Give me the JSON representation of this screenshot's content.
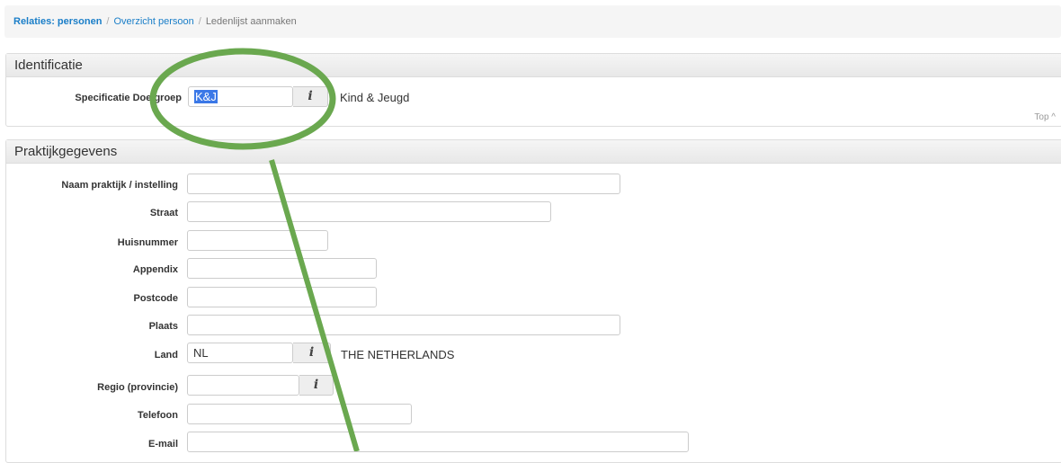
{
  "breadcrumb": {
    "items": [
      "Relaties: personen",
      "Overzicht persoon",
      "Ledenlijst aanmaken"
    ],
    "separator": "/"
  },
  "identificatie": {
    "title": "Identificatie",
    "field_label": "Specificatie Doelgroep",
    "value": "K&J",
    "description": "Kind & Jeugd",
    "top_link": "Top ^",
    "info_icon": "info-icon"
  },
  "praktijk": {
    "title": "Praktijkgegevens",
    "fields": {
      "naam": {
        "label": "Naam praktijk / instelling",
        "value": ""
      },
      "straat": {
        "label": "Straat",
        "value": ""
      },
      "huisnummer": {
        "label": "Huisnummer",
        "value": ""
      },
      "appendix": {
        "label": "Appendix",
        "value": ""
      },
      "postcode": {
        "label": "Postcode",
        "value": ""
      },
      "plaats": {
        "label": "Plaats",
        "value": ""
      },
      "land": {
        "label": "Land",
        "value": "NL",
        "description": "THE NETHERLANDS"
      },
      "regio": {
        "label": "Regio (provincie)",
        "value": ""
      },
      "telefoon": {
        "label": "Telefoon",
        "value": ""
      },
      "email": {
        "label": "E-mail",
        "value": ""
      }
    }
  },
  "annotation": {
    "color": "#6aa84f",
    "shape": "circle-with-arrow"
  },
  "colors": {
    "link": "#1a7ec8",
    "selection": "#3b78e7"
  }
}
